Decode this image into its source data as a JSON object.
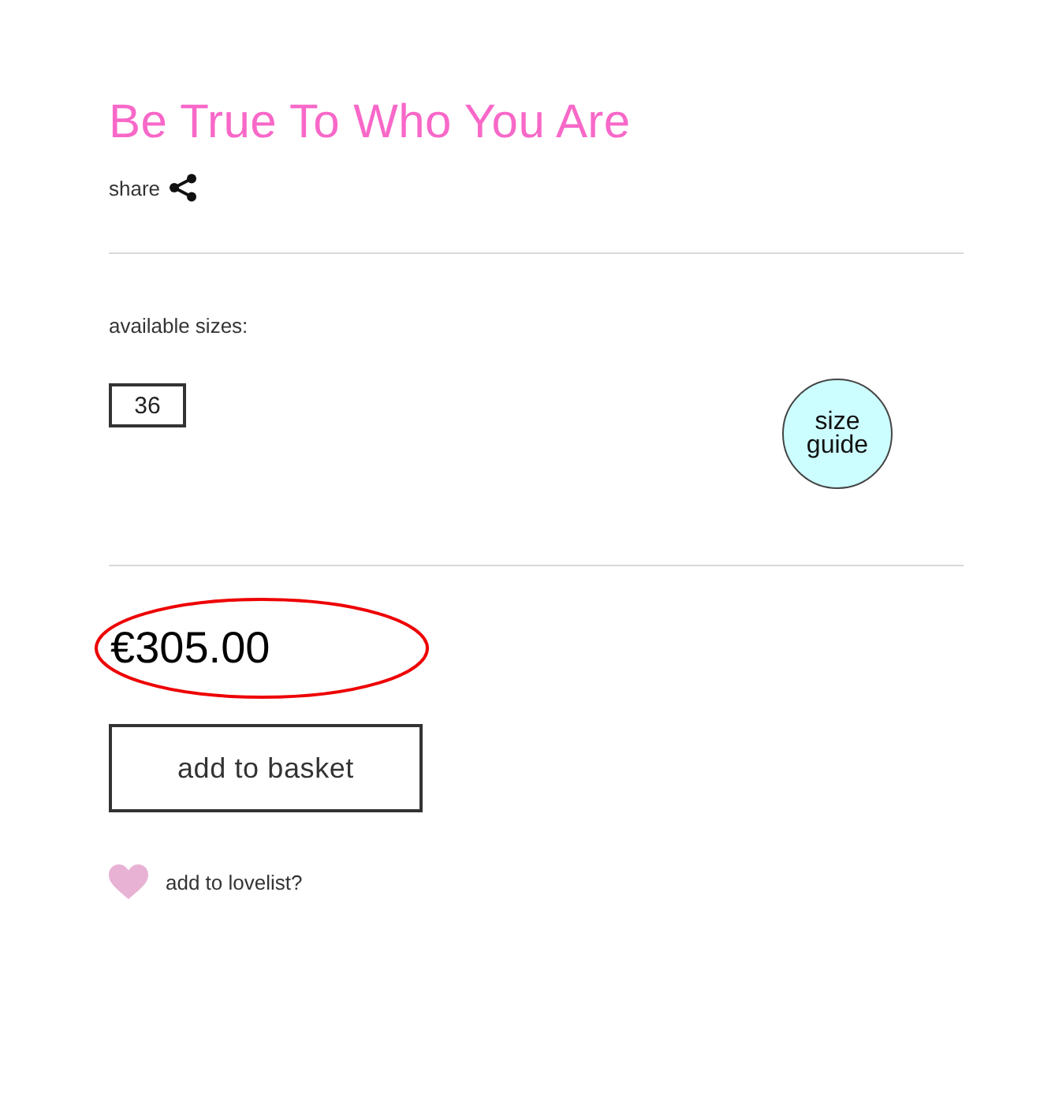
{
  "product": {
    "title": "Be True To Who You Are",
    "share_label": "share"
  },
  "sizes": {
    "label": "available sizes:",
    "options": [
      {
        "label": "36",
        "selected": false
      }
    ],
    "size_guide": "size guide"
  },
  "price": {
    "amount": "€305.00",
    "circled": true
  },
  "basket_button": "add to basket",
  "lovelist": {
    "label": "add to lovelist?"
  }
}
